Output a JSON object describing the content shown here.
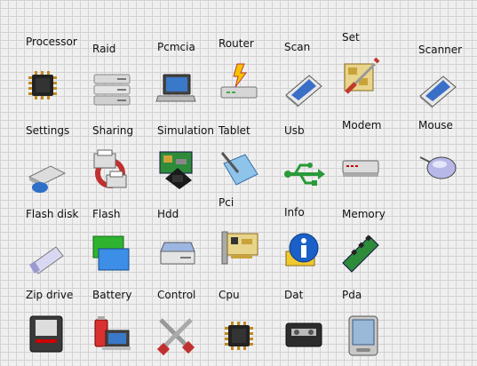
{
  "items": [
    {
      "label": "Processor",
      "icon": "processor-icon"
    },
    {
      "label": "Raid",
      "icon": "raid-icon"
    },
    {
      "label": "Pcmcia",
      "icon": "pcmcia-icon"
    },
    {
      "label": "Router",
      "icon": "router-icon"
    },
    {
      "label": "Scan",
      "icon": "scan-icon"
    },
    {
      "label": "Set",
      "icon": "set-icon"
    },
    {
      "label": "Scanner",
      "icon": "scanner-icon"
    },
    {
      "label": "Settings",
      "icon": "settings-icon"
    },
    {
      "label": "Sharing",
      "icon": "sharing-icon"
    },
    {
      "label": "Simulation",
      "icon": "simulation-icon"
    },
    {
      "label": "Tablet",
      "icon": "tablet-icon"
    },
    {
      "label": "Usb",
      "icon": "usb-icon"
    },
    {
      "label": "Modem",
      "icon": "modem-icon"
    },
    {
      "label": "Mouse",
      "icon": "mouse-icon"
    },
    {
      "label": "Flash disk",
      "icon": "flash-disk-icon"
    },
    {
      "label": "Flash",
      "icon": "flash-icon"
    },
    {
      "label": "Hdd",
      "icon": "hdd-icon"
    },
    {
      "label": "Pci",
      "icon": "pci-icon"
    },
    {
      "label": "Info",
      "icon": "info-icon"
    },
    {
      "label": "Memory",
      "icon": "memory-icon"
    },
    {
      "label": "Zip drive",
      "icon": "zip-drive-icon"
    },
    {
      "label": "Battery",
      "icon": "battery-icon"
    },
    {
      "label": "Control",
      "icon": "control-icon"
    },
    {
      "label": "Cpu",
      "icon": "cpu-icon"
    },
    {
      "label": "Dat",
      "icon": "dat-icon"
    },
    {
      "label": "Pda",
      "icon": "pda-icon"
    }
  ]
}
